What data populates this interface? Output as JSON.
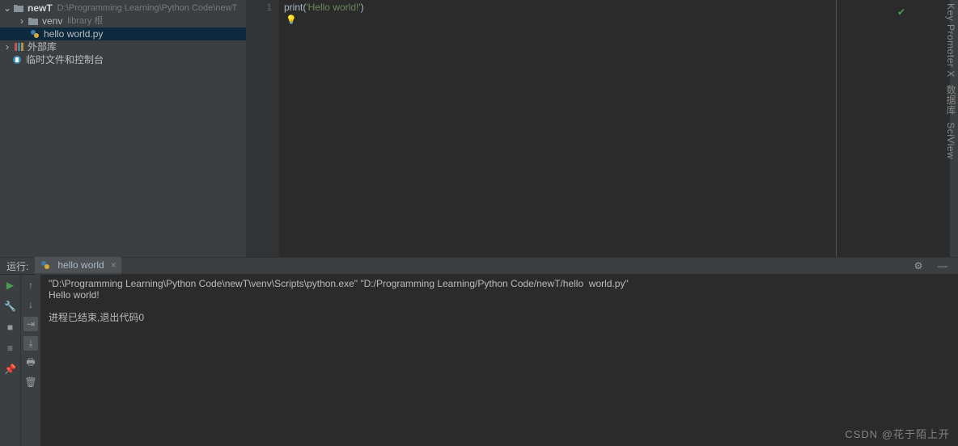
{
  "project_tree": {
    "root": {
      "name": "newT",
      "path": "D:\\Programming Learning\\Python Code\\newT"
    },
    "venv": {
      "name": "venv",
      "hint": "library 根"
    },
    "file": {
      "name": "hello  world.py"
    },
    "ext_libs": "外部库",
    "scratch": "临时文件和控制台"
  },
  "editor": {
    "line_number": "1",
    "code_prefix": "print(",
    "code_str": "'Hello world!'",
    "code_suffix": ")"
  },
  "run_panel": {
    "label": "运行:",
    "tab_name": "hello  world",
    "output_line1": "\"D:\\Programming Learning\\Python Code\\newT\\venv\\Scripts\\python.exe\" \"D:/Programming Learning/Python Code/newT/hello  world.py\"",
    "output_line2": "Hello world!",
    "output_exit": "进程已结束,退出代码0"
  },
  "right_sidebar": {
    "label1": "Key Promoter X",
    "label2": "数据库",
    "label3": "SciView"
  },
  "watermark": "CSDN @花于陌上开"
}
